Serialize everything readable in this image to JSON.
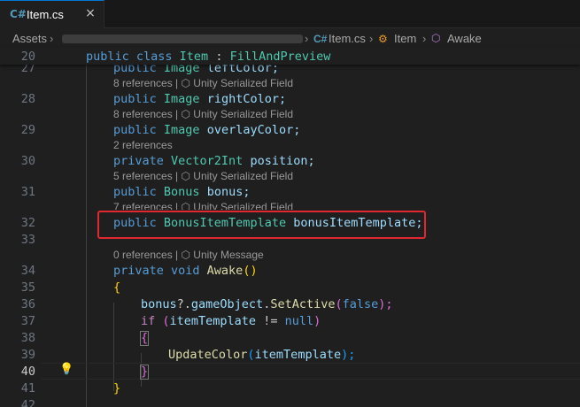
{
  "tab": {
    "icon": "csharp-file-icon",
    "label": "Item.cs",
    "close": "×"
  },
  "breadcrumb": {
    "root": "Assets",
    "file": "Item.cs",
    "class": "Item",
    "method": "Awake",
    "separator": "›"
  },
  "sticky": {
    "line": "20",
    "text": "public class Item : FillAndPreview"
  },
  "lenses": {
    "l28": "8 references | ⬡ Unity Serialized Field",
    "l29": "8 references | ⬡ Unity Serialized Field",
    "l30": "2 references",
    "l31": "5 references | ⬡ Unity Serialized Field",
    "l32": "7 references | ⬡ Unity Serialized Field",
    "l34": "0 references | ⬡ Unity Message"
  },
  "lines": {
    "n27": "27",
    "n28": "28",
    "n29": "29",
    "n30": "30",
    "n31": "31",
    "n32": "32",
    "n33": "33",
    "n34": "34",
    "n35": "35",
    "n36": "36",
    "n37": "37",
    "n38": "38",
    "n39": "39",
    "n40": "40",
    "n41": "41",
    "n42": "42"
  },
  "code": {
    "l27": [
      "public ",
      "Image ",
      "leftColor;"
    ],
    "l28": [
      "public ",
      "Image ",
      "rightColor;"
    ],
    "l29": [
      "public ",
      "Image ",
      "overlayColor;"
    ],
    "l30": [
      "private ",
      "Vector2Int ",
      "position;"
    ],
    "l31": [
      "public ",
      "Bonus ",
      "bonus;"
    ],
    "l32": [
      "public ",
      "BonusItemTemplate ",
      "bonusItemTemplate;"
    ],
    "l34": [
      "private ",
      "void ",
      "Awake",
      "()"
    ],
    "l35": "{",
    "l36": [
      "bonus",
      "?.",
      "gameObject",
      ".",
      "SetActive",
      "(",
      "false",
      ");"
    ],
    "l37": [
      "if ",
      "(",
      "itemTemplate ",
      "!= ",
      "null",
      ")"
    ],
    "l38": "{",
    "l39": [
      "UpdateColor",
      "(",
      "itemTemplate",
      ");"
    ],
    "l40": "}",
    "l41": "}"
  },
  "colors": {
    "accent": "#0078d4",
    "highlight": "#e0282e",
    "keyword": "#569cd6",
    "type": "#4ec9b0"
  },
  "icons": {
    "lightbulb": "lightbulb-icon"
  }
}
